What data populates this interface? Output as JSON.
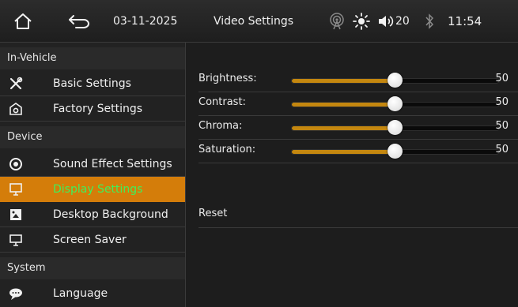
{
  "topbar": {
    "date": "03-11-2025",
    "title": "Video Settings",
    "volume": "20",
    "time": "11:54"
  },
  "sidebar": {
    "sections": {
      "in_vehicle": "In-Vehicle",
      "device": "Device",
      "system": "System"
    },
    "items": [
      {
        "label": "Basic Settings",
        "icon": "tools-icon"
      },
      {
        "label": "Factory Settings",
        "icon": "factory-icon"
      },
      {
        "label": "Sound Effect Settings",
        "icon": "sound-effect-icon"
      },
      {
        "label": "Display Settings",
        "icon": "display-icon",
        "active": true
      },
      {
        "label": "Desktop Background",
        "icon": "wallpaper-icon"
      },
      {
        "label": "Screen Saver",
        "icon": "monitor-icon"
      },
      {
        "label": "Language",
        "icon": "speech-bubble-icon"
      }
    ]
  },
  "settings": [
    {
      "label": "Brightness:",
      "value": "50",
      "level": 0.5
    },
    {
      "label": "Contrast:",
      "value": "50",
      "level": 0.5
    },
    {
      "label": "Chroma:",
      "value": "50",
      "level": 0.5
    },
    {
      "label": "Saturation:",
      "value": "50",
      "level": 0.5
    }
  ],
  "reset_label": "Reset",
  "colors": {
    "accent": "#d47d0a",
    "active_text": "#3ff05a",
    "slider_fill": "#c4870f",
    "background": "#1b1b1b"
  }
}
